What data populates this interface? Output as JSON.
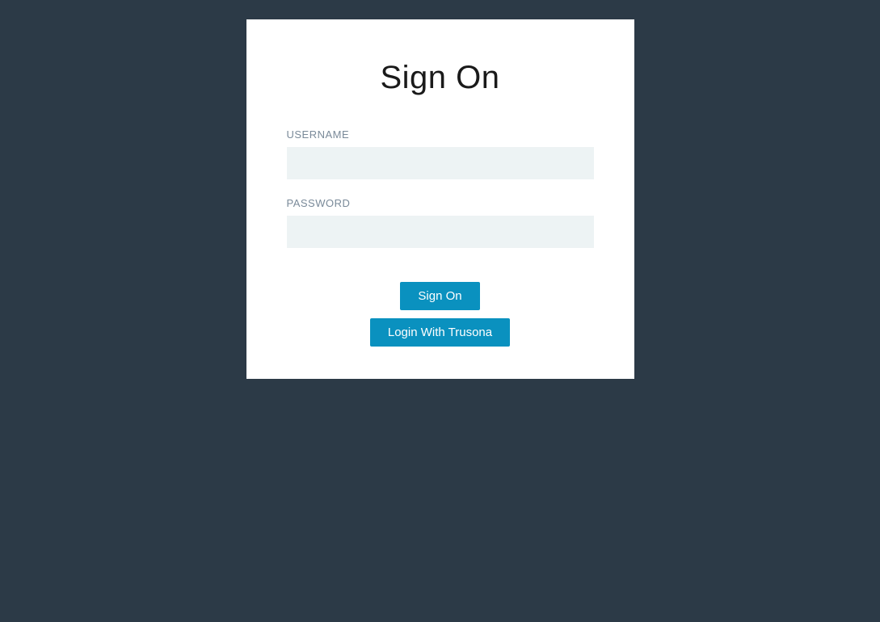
{
  "title": "Sign On",
  "form": {
    "username_label": "USERNAME",
    "username_value": "",
    "password_label": "PASSWORD",
    "password_value": ""
  },
  "buttons": {
    "sign_on": "Sign On",
    "trusona": "Login With Trusona"
  }
}
